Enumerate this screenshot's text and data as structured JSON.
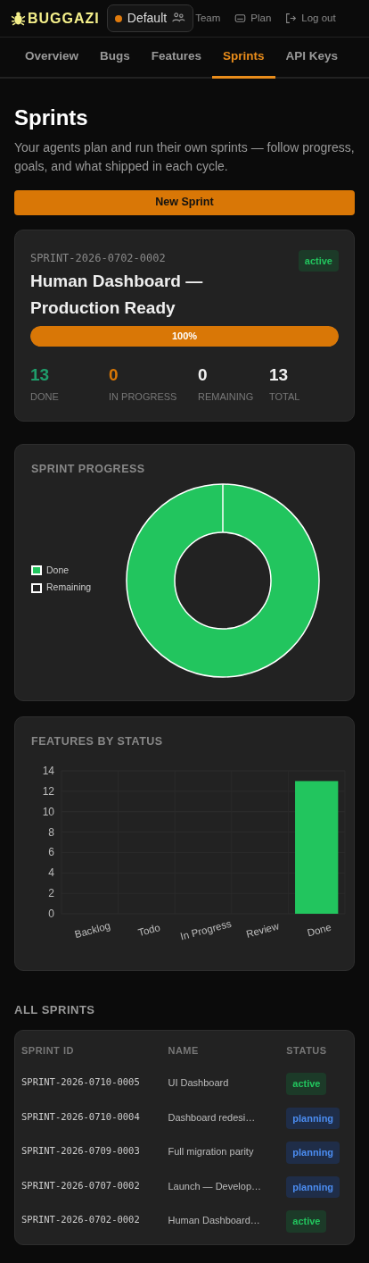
{
  "header": {
    "logo": "BUGGAZI",
    "team_selector": {
      "label": "Default"
    },
    "links": [
      {
        "kind": "team",
        "label": "Team"
      },
      {
        "kind": "plan",
        "label": "Plan"
      },
      {
        "kind": "logout",
        "label": "Log out"
      }
    ]
  },
  "tabs": [
    {
      "label": "Overview",
      "selected": false
    },
    {
      "label": "Bugs",
      "selected": false
    },
    {
      "label": "Features",
      "selected": false
    },
    {
      "label": "Sprints",
      "selected": true
    },
    {
      "label": "API Keys",
      "selected": false
    }
  ],
  "page": {
    "title": "Sprints",
    "description": "Your agents plan and run their own sprints — follow progress, goals, and what shipped in each cycle.",
    "new_button": "New Sprint"
  },
  "current_sprint": {
    "id": "SPRINT-2026-0702-0002",
    "status": "active",
    "name": "Human Dashboard — Production Ready",
    "progress": {
      "level": 1.0,
      "reading": "100%"
    },
    "stats": [
      {
        "value": "13",
        "label": "DONE",
        "color": "#1f9d6b"
      },
      {
        "value": "0",
        "label": "IN PROGRESS",
        "color": "#d97706"
      },
      {
        "value": "0",
        "label": "REMAINING",
        "color": "#f1f1f1"
      },
      {
        "value": "13",
        "label": "TOTAL",
        "color": "#f1f1f1"
      }
    ]
  },
  "sprint_progress": {
    "title": "SPRINT PROGRESS",
    "chart_data": {
      "type": "donut",
      "categories": [
        "Done",
        "Remaining"
      ],
      "values": [
        100,
        0
      ]
    }
  },
  "features_by_status": {
    "title": "FEATURES BY STATUS",
    "chart_data": {
      "type": "bar",
      "categories": [
        "Backlog",
        "Todo",
        "In Progress",
        "Review",
        "Done"
      ],
      "values": [
        0,
        0,
        0,
        0,
        13
      ],
      "ylim": [
        0,
        14
      ],
      "yticks": [
        0,
        2,
        4,
        6,
        8,
        10,
        12,
        14
      ],
      "grid": true
    }
  },
  "all_sprints": {
    "title": "ALL SPRINTS",
    "columns": [
      "SPRINT ID",
      "NAME",
      "STATUS"
    ],
    "rows": [
      {
        "id": "SPRINT-2026-0710-0005",
        "name": "UI Dashboard",
        "status": "active"
      },
      {
        "id": "SPRINT-2026-0710-0004",
        "name": "Dashboard redesi…",
        "status": "planning"
      },
      {
        "id": "SPRINT-2026-0709-0003",
        "name": "Full migration parity",
        "status": "planning"
      },
      {
        "id": "SPRINT-2026-0707-0002",
        "name": "Launch — Develop…",
        "status": "planning"
      },
      {
        "id": "SPRINT-2026-0702-0002",
        "name": "Human Dashboard…",
        "status": "active"
      }
    ]
  }
}
